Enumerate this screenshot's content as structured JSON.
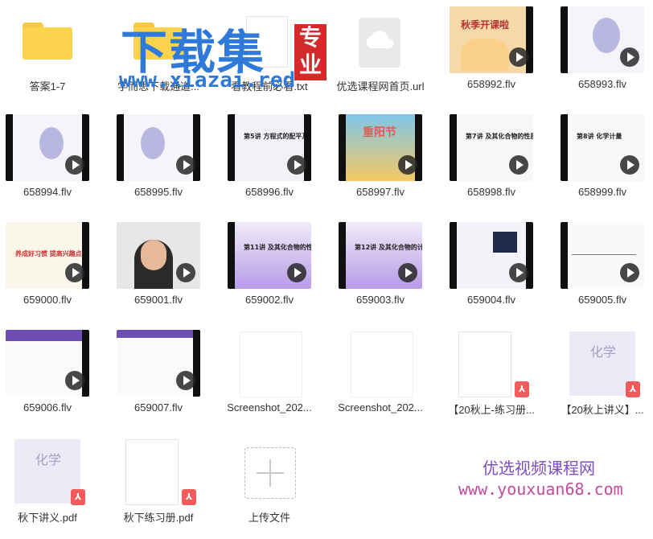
{
  "files": [
    {
      "name": "答案1-7",
      "type": "folder"
    },
    {
      "name": "学而思下载通道...",
      "type": "folder"
    },
    {
      "name": "看教程前必看.txt",
      "type": "text"
    },
    {
      "name": "优选课程网首页.url",
      "type": "url"
    },
    {
      "name": "658992.flv",
      "type": "video",
      "title": "秋季开课啦"
    },
    {
      "name": "658993.flv",
      "type": "video"
    },
    {
      "name": "658994.flv",
      "type": "video"
    },
    {
      "name": "658995.flv",
      "type": "video"
    },
    {
      "name": "658996.flv",
      "type": "video",
      "title": "第5讲 方程式的配平及计算"
    },
    {
      "name": "658997.flv",
      "type": "video",
      "title": "重阳节"
    },
    {
      "name": "658998.flv",
      "type": "video",
      "title": "第7讲 及其化合物的性质"
    },
    {
      "name": "658999.flv",
      "type": "video",
      "title": "第8讲 化学计量"
    },
    {
      "name": "659000.flv",
      "type": "video",
      "title": "养成好习惯 提高兴趣点"
    },
    {
      "name": "659001.flv",
      "type": "video"
    },
    {
      "name": "659002.flv",
      "type": "video",
      "title": "第11讲 及其化合物的性质"
    },
    {
      "name": "659003.flv",
      "type": "video",
      "title": "第12讲 及其化合物的计算"
    },
    {
      "name": "659004.flv",
      "type": "video"
    },
    {
      "name": "659005.flv",
      "type": "video"
    },
    {
      "name": "659006.flv",
      "type": "video"
    },
    {
      "name": "659007.flv",
      "type": "video"
    },
    {
      "name": "Screenshot_202...",
      "type": "image"
    },
    {
      "name": "Screenshot_202...",
      "type": "image"
    },
    {
      "name": "【20秋上-练习册...",
      "type": "pdf"
    },
    {
      "name": "【20秋上讲义】...",
      "type": "pdf",
      "cover": "化学"
    },
    {
      "name": "秋下讲义.pdf",
      "type": "pdf",
      "cover": "化学"
    },
    {
      "name": "秋下练习册.pdf",
      "type": "pdf"
    }
  ],
  "upload": {
    "label": "上传文件"
  },
  "watermarks": {
    "top_cn": "下载集",
    "top_url": "www.xiazai.red",
    "top_badge": "专业",
    "bottom_cn": "优选视频课程网",
    "bottom_url": "www.youxuan68.com"
  },
  "colors": {
    "folder": "#fcd34d",
    "pdf_badge": "#f25b5b",
    "wm_blue": "#2f79d8",
    "wm_purple": "#7e4cc4"
  }
}
